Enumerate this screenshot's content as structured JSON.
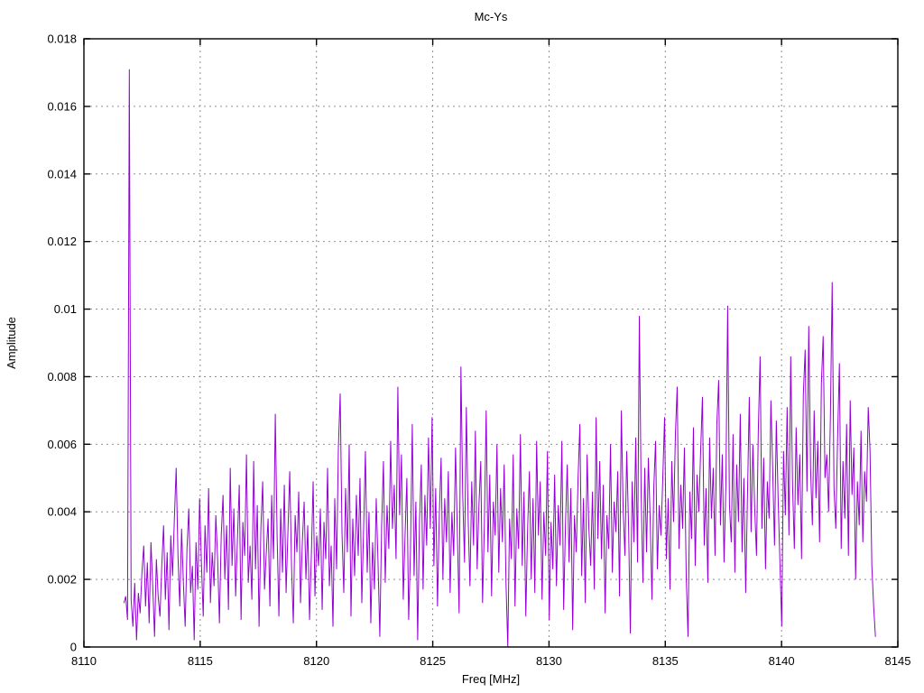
{
  "title": "Mc-Ys",
  "colors": {
    "line": "#9400d3",
    "grid": "#909090",
    "border": "#000000",
    "background": "#ffffff",
    "text": "#000000"
  },
  "chart_data": {
    "type": "line",
    "title": "Mc-Ys",
    "xlabel": "Freq [MHz]",
    "ylabel": "Amplitude",
    "xlim": [
      8110,
      8145
    ],
    "ylim": [
      0,
      0.018
    ],
    "x_ticks": [
      "8110",
      "8115",
      "8120",
      "8125",
      "8130",
      "8135",
      "8140",
      "8145"
    ],
    "x_tick_values": [
      8110,
      8115,
      8120,
      8125,
      8130,
      8135,
      8140,
      8145
    ],
    "y_ticks": [
      "0",
      "0.002",
      "0.004",
      "0.006",
      "0.008",
      "0.01",
      "0.012",
      "0.014",
      "0.016",
      "0.018"
    ],
    "y_tick_values": [
      0,
      0.002,
      0.004,
      0.006,
      0.008,
      0.01,
      0.012,
      0.014,
      0.016,
      0.018
    ],
    "grid": true,
    "legend": "none",
    "line_color": "#9400d3",
    "x_start": 8111.72,
    "x_step": 0.0775,
    "amp_scale": 0.0001,
    "peak": {
      "x": 8111.95,
      "y": 0.0171
    },
    "values_x1e4": [
      13,
      15,
      8,
      171,
      14,
      6,
      19,
      2,
      16,
      10,
      22,
      30,
      12,
      25,
      7,
      31,
      18,
      3,
      26,
      15,
      9,
      24,
      36,
      14,
      28,
      5,
      33,
      21,
      38,
      53,
      27,
      12,
      35,
      19,
      6,
      29,
      41,
      16,
      24,
      2,
      31,
      17,
      44,
      25,
      9,
      36,
      22,
      47,
      13,
      28,
      18,
      39,
      26,
      7,
      33,
      45,
      20,
      36,
      11,
      53,
      24,
      41,
      15,
      32,
      48,
      8,
      37,
      27,
      57,
      19,
      30,
      14,
      55,
      23,
      42,
      6,
      35,
      49,
      17,
      28,
      38,
      12,
      45,
      26,
      69,
      33,
      9,
      41,
      22,
      48,
      16,
      34,
      52,
      24,
      7,
      39,
      28,
      46,
      13,
      31,
      43,
      20,
      36,
      8,
      27,
      49,
      15,
      33,
      24,
      41,
      11,
      37,
      26,
      53,
      18,
      30,
      6,
      44,
      23,
      59,
      75,
      34,
      16,
      47,
      28,
      60,
      9,
      38,
      21,
      45,
      27,
      50,
      13,
      35,
      58,
      22,
      40,
      7,
      31,
      17,
      44,
      25,
      3,
      36,
      55,
      19,
      42,
      29,
      61,
      35,
      48,
      26,
      77,
      39,
      57,
      14,
      33,
      50,
      8,
      28,
      66,
      21,
      43,
      2,
      37,
      54,
      17,
      45,
      30,
      62,
      35,
      68,
      24,
      47,
      12,
      39,
      56,
      20,
      44,
      31,
      52,
      16,
      40,
      27,
      59,
      34,
      10,
      83,
      45,
      25,
      71,
      38,
      18,
      49,
      30,
      64,
      23,
      42,
      55,
      13,
      36,
      70,
      28,
      51,
      15,
      43,
      33,
      60,
      22,
      47,
      31,
      54,
      19,
      0,
      38,
      26,
      57,
      12,
      41,
      29,
      63,
      24,
      46,
      9,
      35,
      52,
      20,
      44,
      16,
      61,
      33,
      49,
      14,
      40,
      27,
      58,
      8,
      37,
      23,
      51,
      18,
      42,
      30,
      61,
      11,
      36,
      54,
      25,
      47,
      5,
      39,
      28,
      50,
      66,
      21,
      44,
      13,
      57,
      35,
      24,
      46,
      17,
      68,
      32,
      55,
      26,
      48,
      10,
      39,
      29,
      60,
      22,
      43,
      34,
      52,
      15,
      70,
      41,
      27,
      58,
      36,
      4,
      49,
      31,
      62,
      25,
      98,
      45,
      19,
      53,
      28,
      56,
      38,
      14,
      47,
      61,
      23,
      42,
      33,
      50,
      68,
      26,
      44,
      17,
      55,
      37,
      63,
      77,
      29,
      48,
      35,
      59,
      21,
      3,
      46,
      32,
      65,
      24,
      51,
      40,
      58,
      74,
      30,
      47,
      19,
      62,
      38,
      53,
      27,
      66,
      79,
      36,
      57,
      25,
      48,
      101,
      42,
      31,
      63,
      22,
      54,
      37,
      69,
      28,
      50,
      16,
      45,
      74,
      34,
      60,
      41,
      27,
      64,
      86,
      35,
      56,
      23,
      49,
      38,
      73,
      52,
      30,
      67,
      44,
      25,
      6,
      58,
      39,
      71,
      33,
      86,
      48,
      29,
      65,
      42,
      57,
      26,
      75,
      88,
      46,
      95,
      53,
      36,
      70,
      44,
      61,
      31,
      78,
      92,
      50,
      57,
      40,
      68,
      108,
      47,
      35,
      62,
      84,
      29,
      55,
      38,
      66,
      27,
      73,
      45,
      59,
      20,
      49,
      36,
      64,
      31,
      52,
      43,
      71,
      58,
      24,
      12,
      3
    ]
  }
}
